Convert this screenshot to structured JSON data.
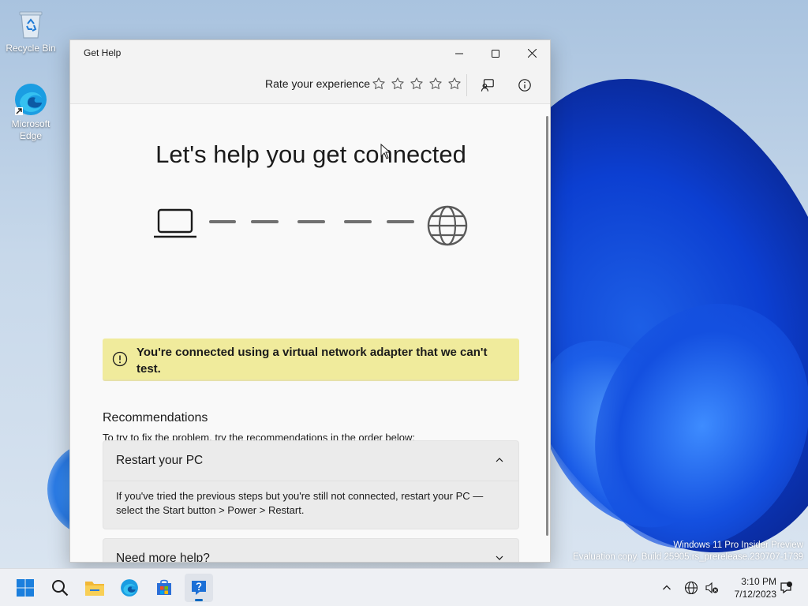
{
  "desktop": {
    "icons": [
      {
        "label": "Recycle Bin",
        "icon": "recycle-bin-icon"
      },
      {
        "label": "Microsoft Edge",
        "icon": "edge-icon"
      }
    ],
    "watermark_line1": "Windows 11 Pro Insider Preview",
    "watermark_line2": "Evaluation copy. Build 25905.rs_prerelease.230707-1739"
  },
  "window": {
    "title": "Get Help",
    "rate_label": "Rate your experience",
    "stars": 5,
    "heading": "Let's help you get connected",
    "notice": "You're connected using a virtual network adapter that we can't test.",
    "recommendations_title": "Recommendations",
    "recommendations_sub": "To try to fix the problem, try the recommendations in the order below:",
    "accordion": [
      {
        "title": "Restart your PC",
        "expanded": true,
        "body": "If you've tried the previous steps but you're still not connected, restart your PC —select the Start button > Power > Restart."
      },
      {
        "title": "Need more help?",
        "expanded": false
      }
    ],
    "colors": {
      "notice_bg": "#f0eb9c",
      "accent": "#0067c0"
    }
  },
  "taskbar": {
    "apps": [
      "start-icon",
      "search-icon",
      "file-explorer-icon",
      "edge-icon",
      "store-icon",
      "get-help-icon"
    ],
    "active_app": "get-help-icon",
    "tray": [
      "chevron-up-icon",
      "network-icon",
      "volume-muted-icon"
    ],
    "time": "3:10 PM",
    "date": "7/12/2023"
  }
}
